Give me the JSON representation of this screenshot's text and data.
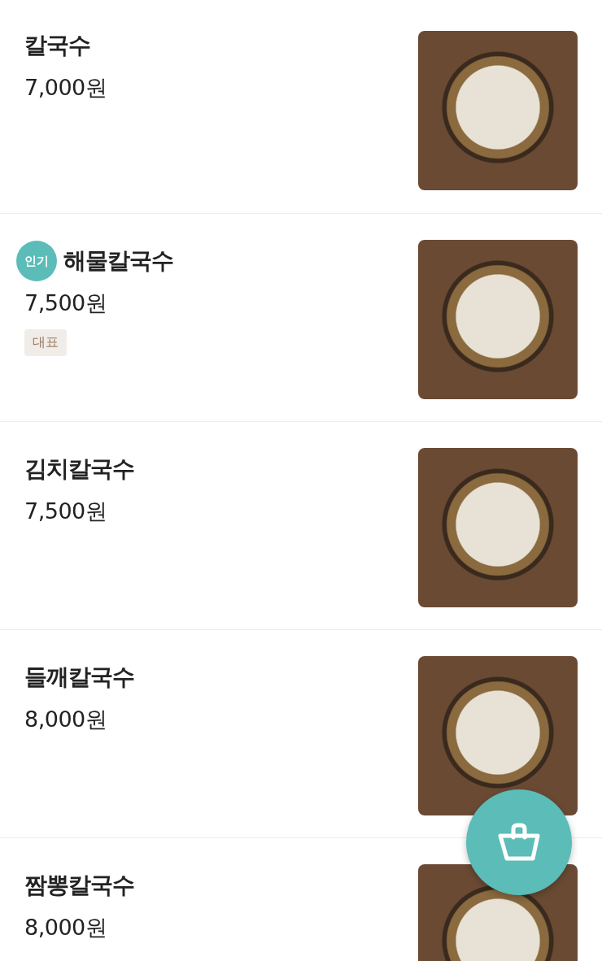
{
  "menu_items": [
    {
      "name": "칼국수",
      "price": "7,000원"
    },
    {
      "name": "해물칼국수",
      "price": "7,500원",
      "badge": "인기",
      "tags": [
        "대표"
      ]
    },
    {
      "name": "김치칼국수",
      "price": "7,500원"
    },
    {
      "name": "들깨칼국수",
      "price": "8,000원"
    },
    {
      "name": "짬뽕칼국수",
      "price": "8,000원"
    }
  ]
}
